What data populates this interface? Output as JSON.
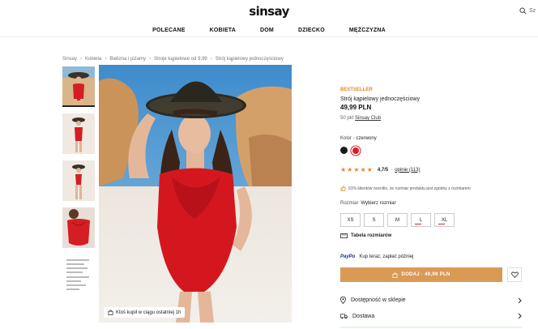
{
  "header": {
    "logo": "sinsay",
    "search_label": "Sz",
    "nav": [
      "POLECANE",
      "KOBIETA",
      "DOM",
      "DZIECKO",
      "MĘŻCZYZNA"
    ]
  },
  "breadcrumb": [
    "Sinsay",
    "Kobieta",
    "Bielizna i piżamy",
    "Stroje kąpielowe od 9,99",
    "Strój kąpielowy jednoczęściowy"
  ],
  "gallery": {
    "badge": "Ktoś kupił w ciągu ostatniej 1h"
  },
  "product": {
    "badge": "BESTSELLER",
    "name": "Strój kąpielowy jednoczęściowy",
    "price": "49,99 PLN",
    "club_text": "50 pkt",
    "club_link": "Sinsay Club",
    "color_label": "Kolor",
    "color_value": "czerwony",
    "rating_value": "4,7/5",
    "rating_link": "opinie (113)",
    "fit_text": "91% klientów ocenił/o, że rozmiar produktu jest zgodny z rozmiarem",
    "size_label": "Rozmiar",
    "size_value": "Wybierz rozmiar",
    "sizes": [
      "XS",
      "S",
      "M",
      "L",
      "XL"
    ],
    "size_table": "Tabela rozmiarów",
    "paypo_logo": "PayPo",
    "paypo_text": "Kup teraz, zapłać później",
    "add_button": "DODAJ · 49,99 PLN",
    "availability": "Dostępność w sklepie",
    "delivery": "Dostawa"
  },
  "colors": {
    "accent": "#d99a56",
    "bestseller": "#e08a2c",
    "swatch_black": "#1a1a1a",
    "swatch_red": "#e01a25"
  }
}
